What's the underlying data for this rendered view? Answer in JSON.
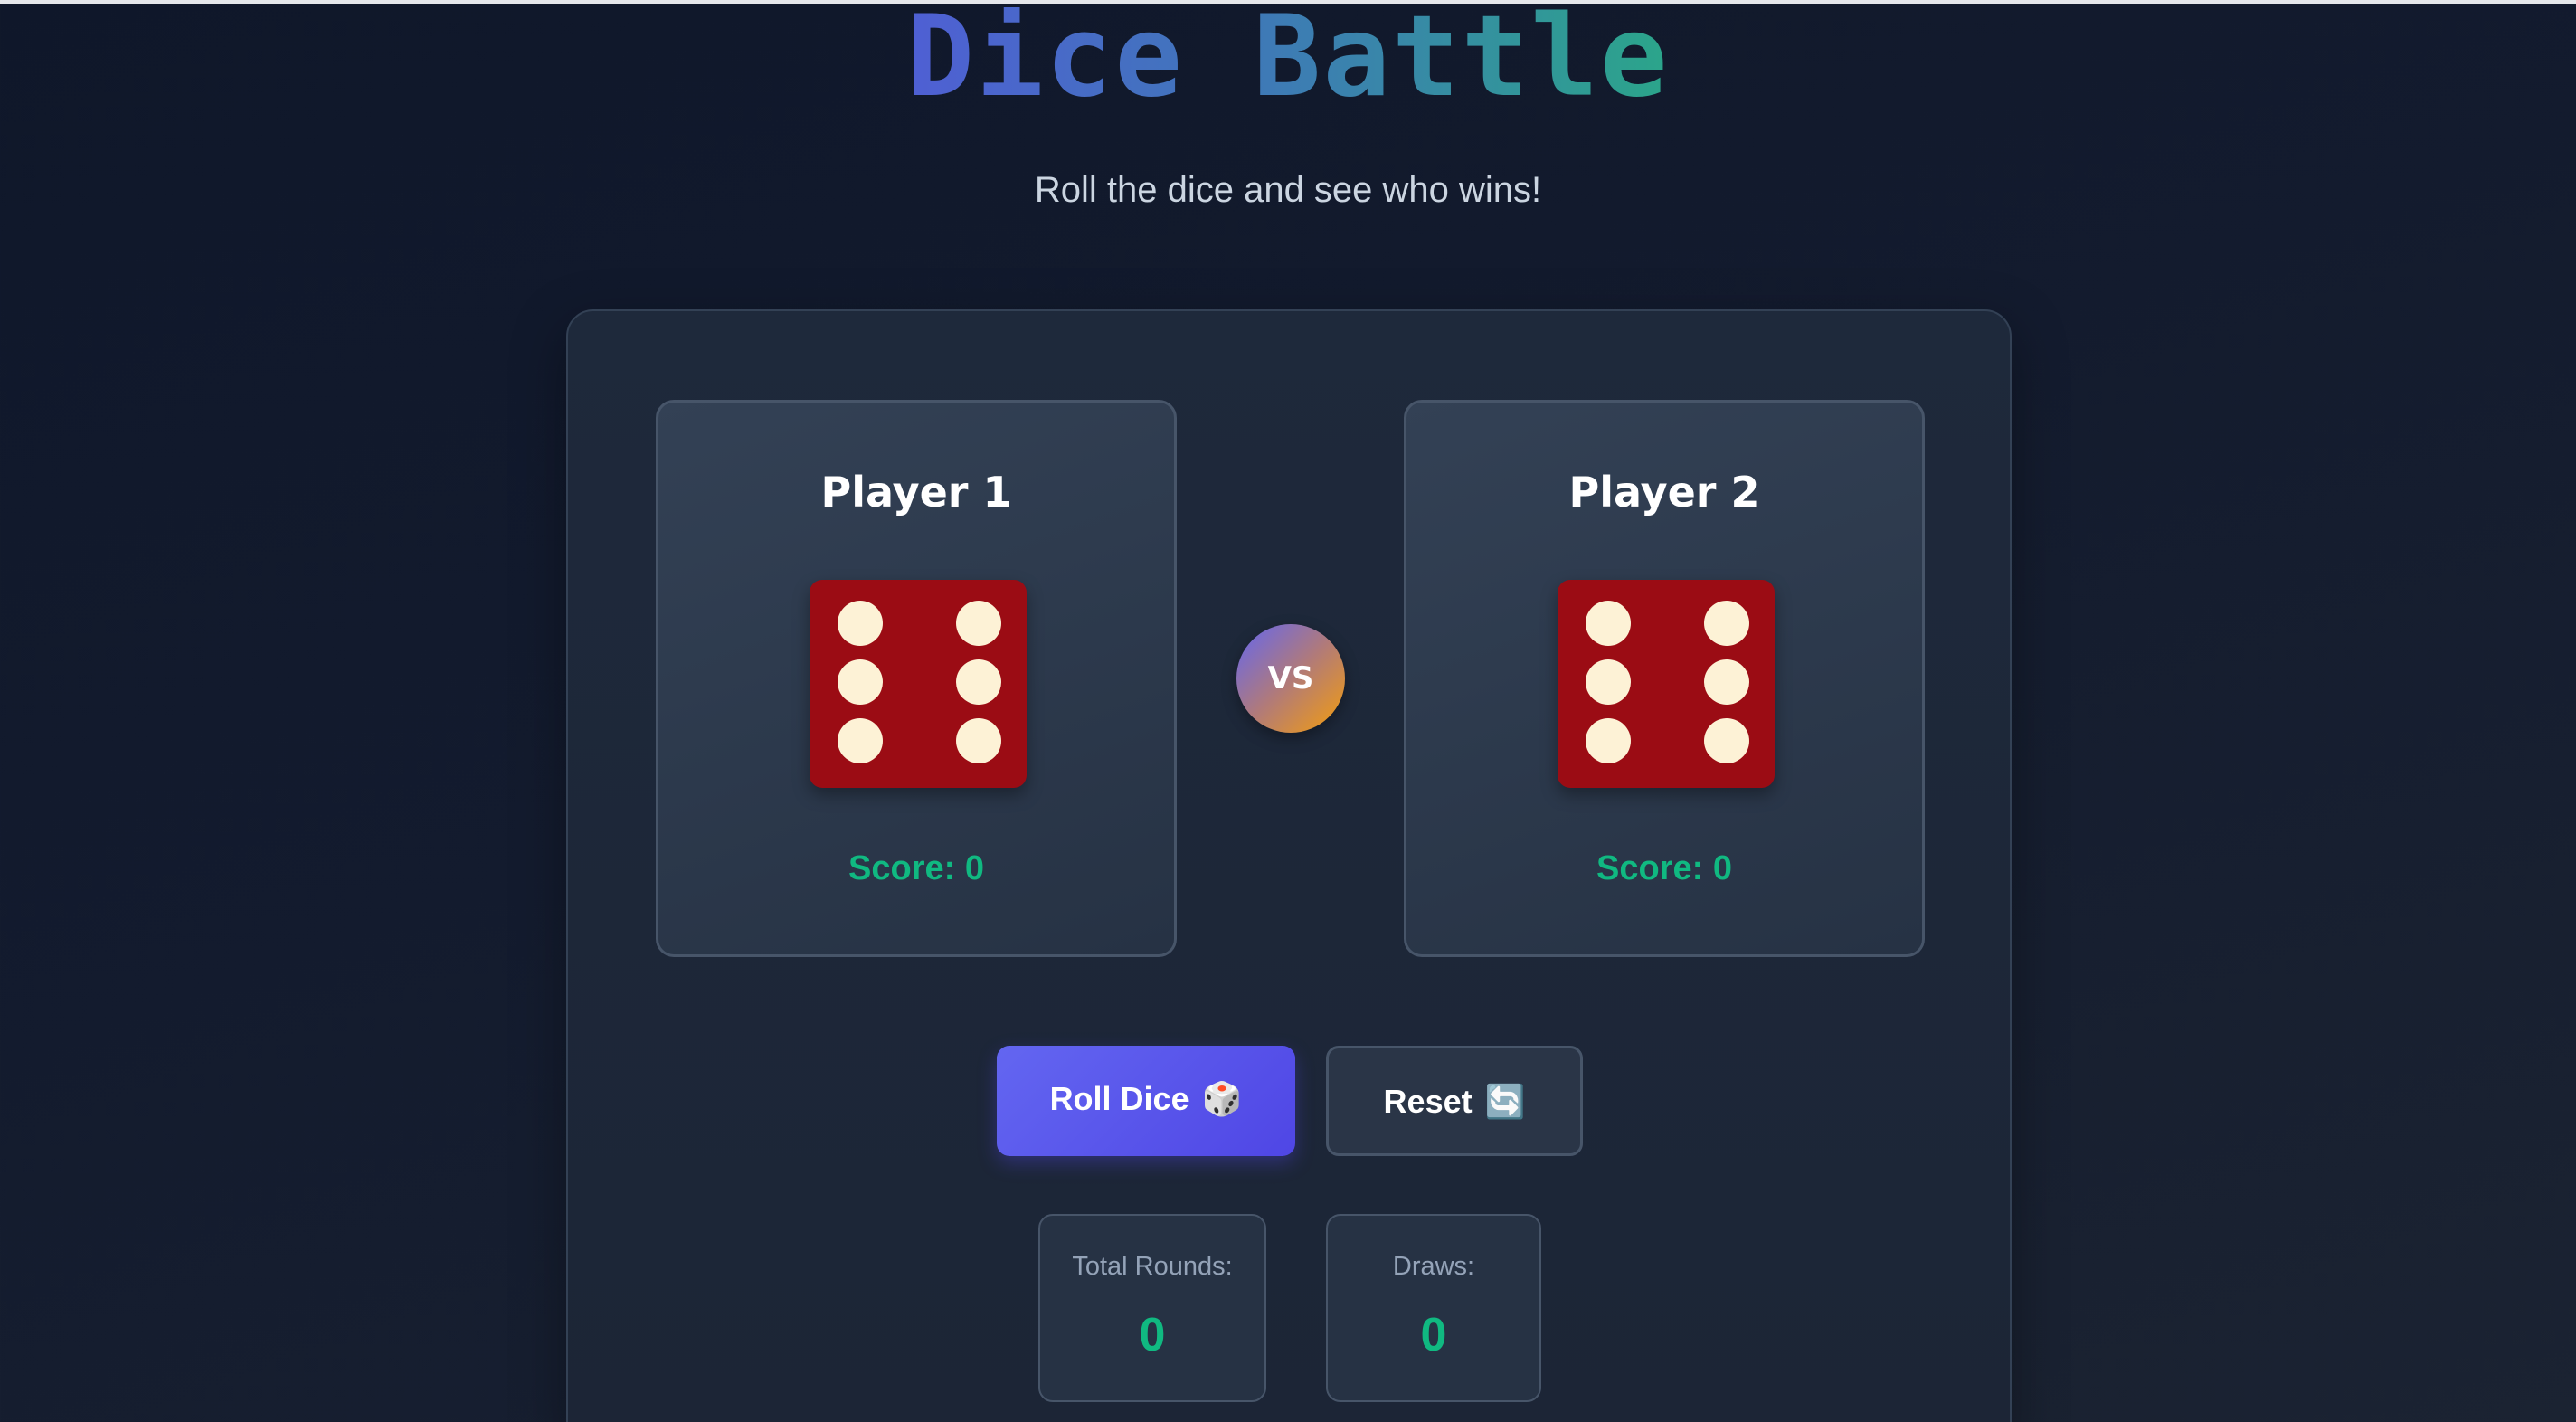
{
  "header": {
    "title": "Dice Battle",
    "subtitle": "Roll the dice and see who wins!"
  },
  "players": [
    {
      "name": "Player 1",
      "die_value": 6,
      "score_label": "Score: 0"
    },
    {
      "name": "Player 2",
      "die_value": 6,
      "score_label": "Score: 0"
    }
  ],
  "vs_label": "VS",
  "buttons": {
    "roll_label": "Roll Dice",
    "roll_icon": "🎲",
    "reset_label": "Reset",
    "reset_icon": "🔄"
  },
  "stats": {
    "total_rounds_label": "Total Rounds:",
    "total_rounds_value": "0",
    "draws_label": "Draws:",
    "draws_value": "0"
  },
  "colors": {
    "background": "#0f172a",
    "accent": "#6366f1",
    "score_green": "#10b981",
    "die_red": "#9b0c14",
    "pip_cream": "#fdf2d6"
  }
}
